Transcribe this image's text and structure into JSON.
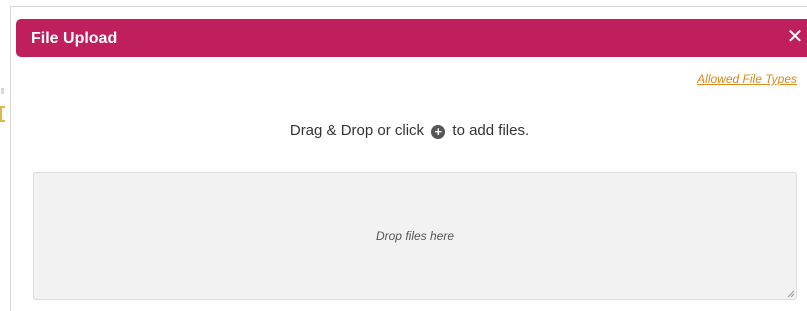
{
  "dialog": {
    "title": "File Upload",
    "close_icon": "close-icon",
    "close_glyph": "✕",
    "allowed_file_types_link": "Allowed File Types",
    "instruction_before": "Drag & Drop or click",
    "instruction_after": "to add files.",
    "plus_icon": "plus-circle-icon",
    "plus_glyph": "+",
    "dropzone_text": "Drop files here"
  },
  "colors": {
    "titlebar": "#bf1f5d",
    "link": "#d68a1c",
    "dropzone_bg": "#f2f2f2"
  }
}
